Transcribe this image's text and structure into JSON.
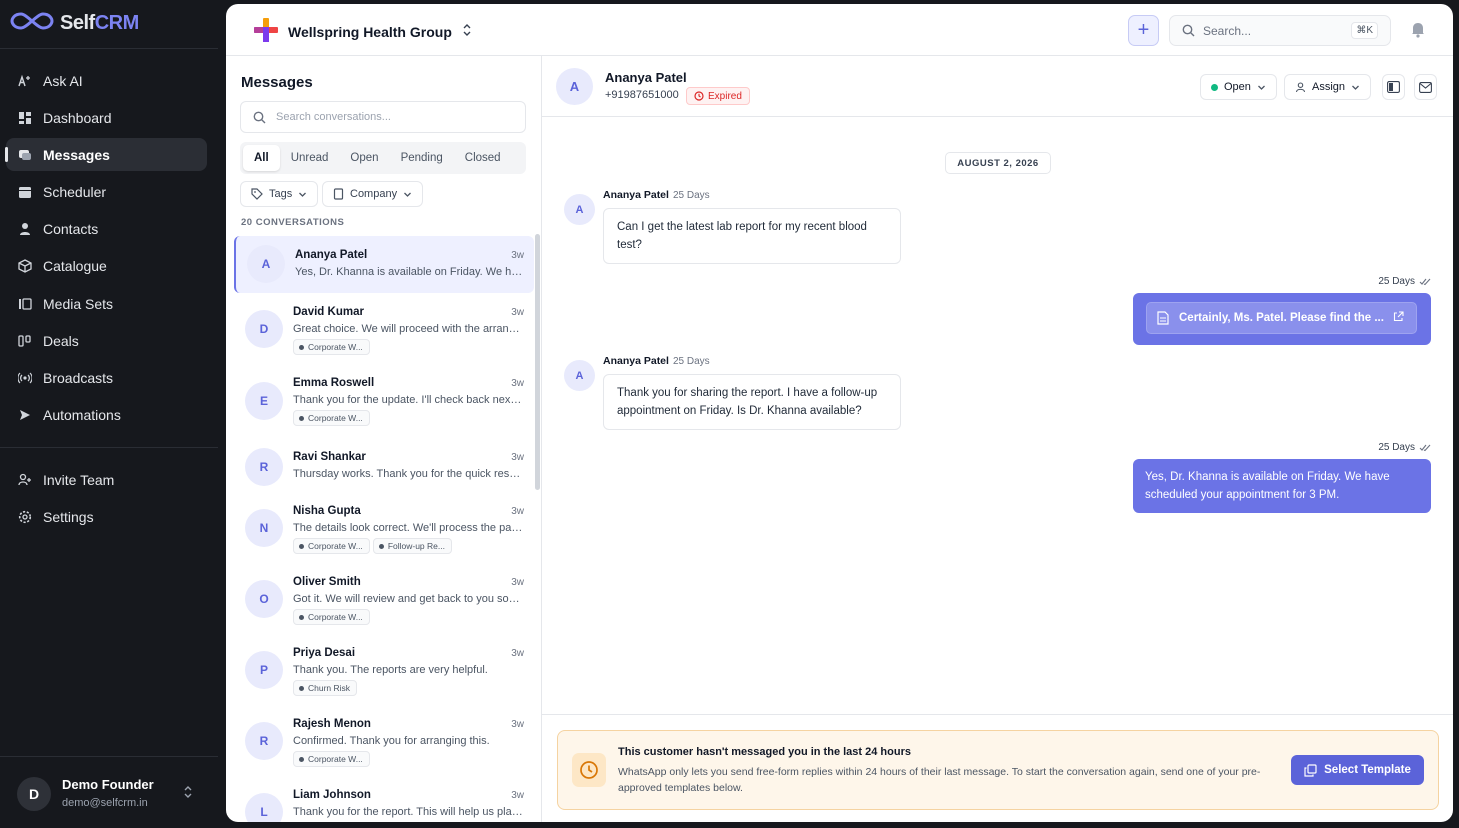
{
  "brand": {
    "name_a": "Self",
    "name_b": "CRM"
  },
  "sidebar": {
    "items": [
      {
        "label": "Ask AI",
        "icon": "sparkle-text-icon"
      },
      {
        "label": "Dashboard",
        "icon": "dashboard-icon"
      },
      {
        "label": "Messages",
        "icon": "chat-icon"
      },
      {
        "label": "Scheduler",
        "icon": "calendar-icon"
      },
      {
        "label": "Contacts",
        "icon": "person-icon"
      },
      {
        "label": "Catalogue",
        "icon": "box-icon"
      },
      {
        "label": "Media Sets",
        "icon": "media-icon"
      },
      {
        "label": "Deals",
        "icon": "deals-icon"
      },
      {
        "label": "Broadcasts",
        "icon": "broadcast-icon"
      },
      {
        "label": "Automations",
        "icon": "automation-icon"
      }
    ],
    "bottom_items": [
      {
        "label": "Invite Team",
        "icon": "add-user-icon"
      },
      {
        "label": "Settings",
        "icon": "gear-icon"
      }
    ],
    "user": {
      "initial": "D",
      "name": "Demo Founder",
      "email": "demo@selfcrm.in"
    }
  },
  "topbar": {
    "org_name": "Wellspring Health Group",
    "search_placeholder": "Search...",
    "search_shortcut": "⌘K"
  },
  "conversations": {
    "title": "Messages",
    "search_placeholder": "Search conversations...",
    "filters": [
      "All",
      "Unread",
      "Open",
      "Pending",
      "Closed"
    ],
    "active_filter": "All",
    "dropdowns": {
      "tags": "Tags",
      "company": "Company"
    },
    "count_label": "20 CONVERSATIONS",
    "items": [
      {
        "initial": "A",
        "name": "Ananya Patel",
        "time": "3w",
        "preview": "Yes, Dr. Khanna is available on Friday. We have...",
        "tags": []
      },
      {
        "initial": "D",
        "name": "David Kumar",
        "time": "3w",
        "preview": "Great choice. We will proceed with the arrange...",
        "tags": [
          "Corporate W..."
        ]
      },
      {
        "initial": "E",
        "name": "Emma Roswell",
        "time": "3w",
        "preview": "Thank you for the update. I'll check back next ...",
        "tags": [
          "Corporate W..."
        ]
      },
      {
        "initial": "R",
        "name": "Ravi Shankar",
        "time": "3w",
        "preview": "Thursday works. Thank you for the quick respo...",
        "tags": []
      },
      {
        "initial": "N",
        "name": "Nisha Gupta",
        "time": "3w",
        "preview": "The details look correct. We'll process the pay...",
        "tags": [
          "Corporate W...",
          "Follow-up Re..."
        ]
      },
      {
        "initial": "O",
        "name": "Oliver Smith",
        "time": "3w",
        "preview": "Got it. We will review and get back to you soon.",
        "tags": [
          "Corporate W..."
        ]
      },
      {
        "initial": "P",
        "name": "Priya Desai",
        "time": "3w",
        "preview": "Thank you. The reports are very helpful.",
        "tags": [
          "Churn Risk"
        ]
      },
      {
        "initial": "R",
        "name": "Rajesh Menon",
        "time": "3w",
        "preview": "Confirmed. Thank you for arranging this.",
        "tags": [
          "Corporate W..."
        ]
      },
      {
        "initial": "L",
        "name": "Liam Johnson",
        "time": "3w",
        "preview": "Thank you for the report. This will help us plan ...",
        "tags": []
      }
    ]
  },
  "chat": {
    "contact": {
      "initial": "A",
      "name": "Ananya Patel",
      "phone": "+91987651000",
      "badge": "Expired"
    },
    "status_label": "Open",
    "assign_label": "Assign",
    "date_label": "AUGUST 2, 2026",
    "messages": [
      {
        "sender": "Ananya Patel",
        "initial": "A",
        "age": "25 Days",
        "text": "Can I get the latest lab report for my recent blood test?"
      },
      {
        "age": "25 Days",
        "doc": "Certainly, Ms. Patel. Please find the ..."
      },
      {
        "sender": "Ananya Patel",
        "initial": "A",
        "age": "25 Days",
        "text": "Thank you for sharing the report. I have a follow-up appointment on Friday. Is Dr. Khanna available?"
      },
      {
        "age": "25 Days",
        "text": "Yes, Dr. Khanna is available on Friday. We have scheduled your appointment for 3 PM."
      }
    ],
    "notice": {
      "title": "This customer hasn't messaged you in the last 24 hours",
      "body": "WhatsApp only lets you send free-form replies within 24 hours of their last message. To start the conversation again, send one of your pre-approved templates below.",
      "button": "Select Template"
    }
  }
}
